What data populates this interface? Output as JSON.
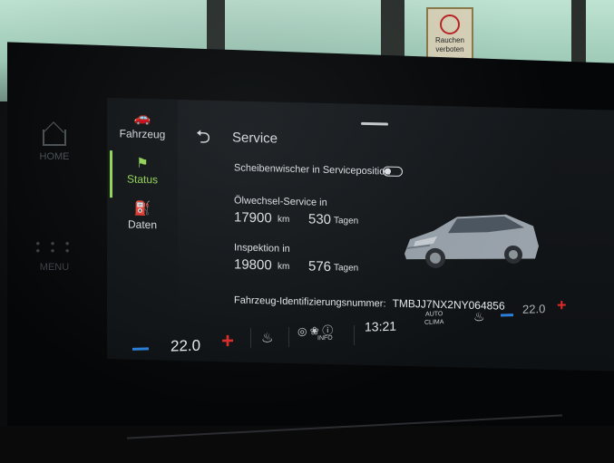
{
  "environment": {
    "sign_text": [
      "Rauchen",
      "verboten"
    ]
  },
  "hardware": {
    "home_label": "HOME",
    "menu_label": "MENU",
    "home_icon": "house-icon",
    "menu_icon": "grid-dots-icon"
  },
  "side_nav": {
    "items": [
      {
        "label": "Fahrzeug",
        "icon": "car-gear-icon",
        "active": false
      },
      {
        "label": "Status",
        "icon": "car-status-icon",
        "active": true
      },
      {
        "label": "Daten",
        "icon": "fuel-data-icon",
        "active": false
      }
    ],
    "active_color": "#9be05a"
  },
  "page": {
    "back_icon": "back-arrow-icon",
    "title": "Service"
  },
  "wiper": {
    "label": "Scheibenwischer in Serviceposition",
    "toggle_on": false
  },
  "oil_service": {
    "label": "Ölwechsel-Service in",
    "km_value": "17900",
    "km_unit": "km",
    "days_value": "530",
    "days_unit": "Tagen"
  },
  "inspection": {
    "label": "Inspektion in",
    "km_value": "19800",
    "km_unit": "km",
    "days_value": "576",
    "days_unit": "Tagen"
  },
  "vin": {
    "label": "Fahrzeug-Identifizierungsnummer:",
    "value": "TMBJJ7NX2NY064856"
  },
  "climate": {
    "left_temp": "22.0",
    "right_temp": "22.0",
    "time": "13:21",
    "info_label": "INFO",
    "auto_label": "AUTO",
    "clima_label": "CLIMA",
    "minus_color": "#2b7fd8",
    "plus_color": "#e02a2a"
  }
}
